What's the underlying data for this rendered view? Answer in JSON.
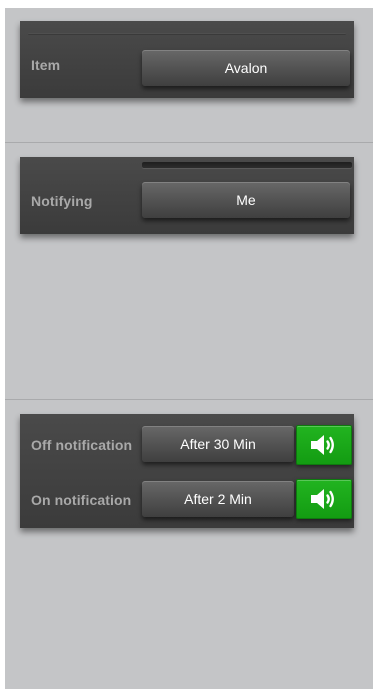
{
  "item_section": {
    "label": "Item",
    "value": "Avalon"
  },
  "notify_section": {
    "label": "Notifying",
    "value": "Me"
  },
  "notifications_section": {
    "off": {
      "label": "Off notification",
      "value": "After 30 Min",
      "icon": "speaker-icon"
    },
    "on": {
      "label": "On notification",
      "value": "After 2 Min",
      "icon": "speaker-icon"
    }
  },
  "colors": {
    "background": "#c4c5c7",
    "card": "#404040",
    "label": "#a9a9a9",
    "accent_green": "#1aa818"
  }
}
